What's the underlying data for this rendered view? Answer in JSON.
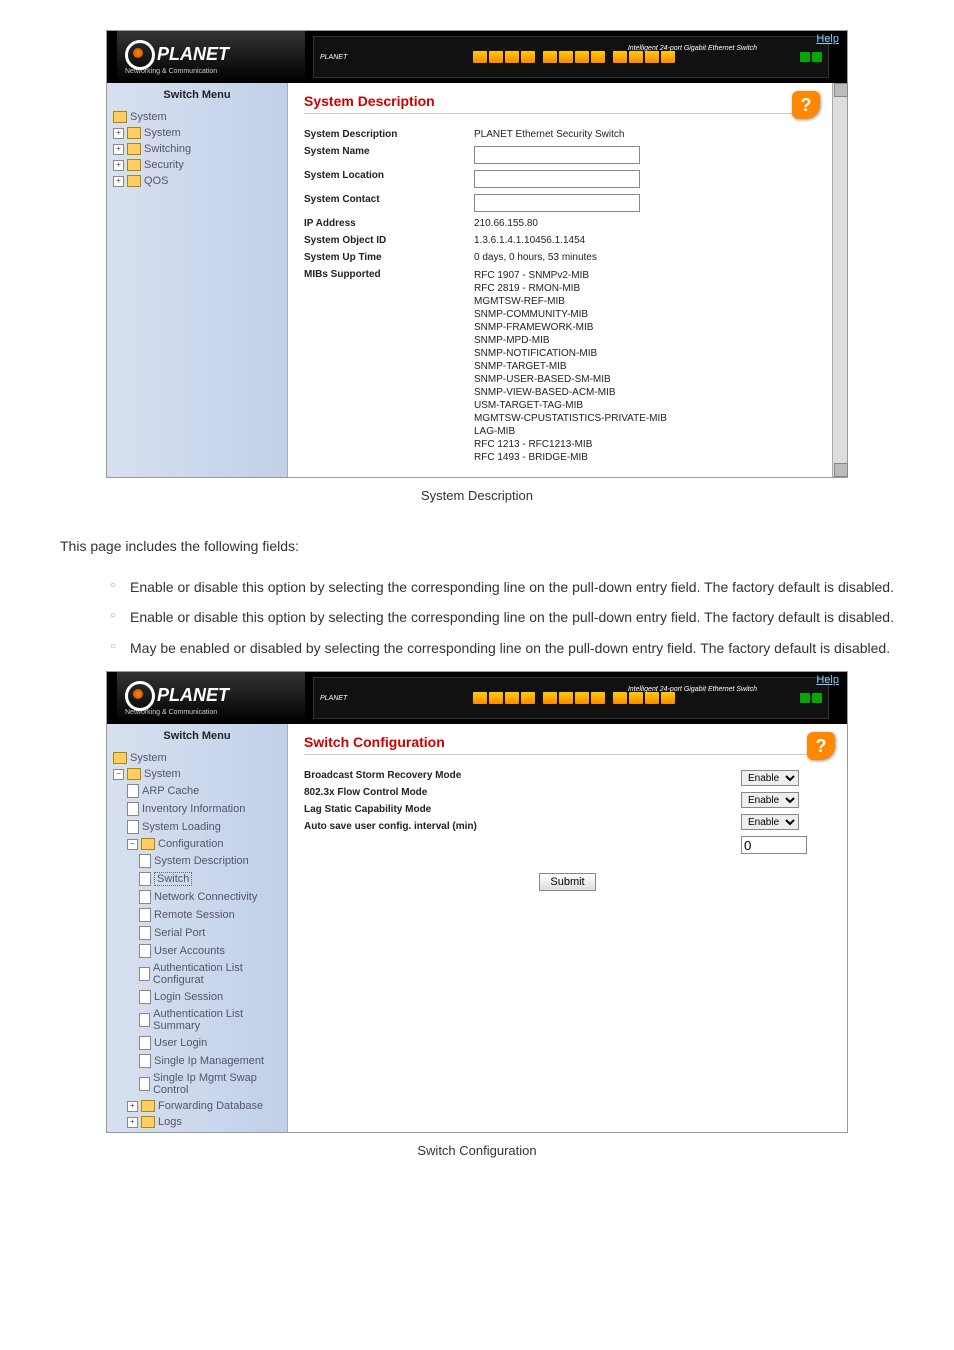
{
  "logo": {
    "brand": "PLANET",
    "tag": "Networking & Communication"
  },
  "banner": {
    "help": "Help",
    "device": "Intelligent 24-port Gigabit Ethernet Switch"
  },
  "shot1": {
    "sidebar_title": "Switch Menu",
    "tree": {
      "root": "System",
      "items": [
        "System",
        "Switching",
        "Security",
        "QOS"
      ]
    },
    "title": "System Description",
    "rows": {
      "desc_label": "System Description",
      "desc_val": "PLANET Ethernet Security Switch",
      "name_label": "System Name",
      "loc_label": "System Location",
      "contact_label": "System Contact",
      "ip_label": "IP Address",
      "ip_val": "210.66.155.80",
      "oid_label": "System Object ID",
      "oid_val": "1.3.6.1.4.1.10456.1.1454",
      "uptime_label": "System Up Time",
      "uptime_val": "0 days, 0 hours, 53 minutes",
      "mibs_label": "MIBs Supported",
      "mibs": [
        "RFC 1907 - SNMPv2-MIB",
        "RFC 2819 - RMON-MIB",
        "MGMTSW-REF-MIB",
        "SNMP-COMMUNITY-MIB",
        "SNMP-FRAMEWORK-MIB",
        "SNMP-MPD-MIB",
        "SNMP-NOTIFICATION-MIB",
        "SNMP-TARGET-MIB",
        "SNMP-USER-BASED-SM-MIB",
        "SNMP-VIEW-BASED-ACM-MIB",
        "USM-TARGET-TAG-MIB",
        "MGMTSW-CPUSTATISTICS-PRIVATE-MIB",
        "LAG-MIB",
        "RFC 1213 - RFC1213-MIB",
        "RFC 1493 - BRIDGE-MIB"
      ]
    }
  },
  "caption1": "System Description",
  "doc": {
    "intro": "This page includes the following fields:",
    "b1": "Enable or disable this option by selecting the corresponding line on the pull-down entry field. The factory default is disabled.",
    "b2": "Enable or disable this option by selecting the corresponding line on the pull-down entry field. The factory default is disabled.",
    "b3": "May be enabled or disabled by selecting the corresponding line on the pull-down entry field. The factory default is disabled."
  },
  "shot2": {
    "sidebar_title": "Switch Menu",
    "tree": {
      "root": "System",
      "l1": "System",
      "items": [
        "ARP Cache",
        "Inventory Information",
        "System Loading"
      ],
      "config": "Configuration",
      "cfg_items": [
        "System Description",
        "Switch",
        "Network Connectivity",
        "Remote Session",
        "Serial Port",
        "User Accounts",
        "Authentication List Configurat",
        "Login Session",
        "Authentication List Summary",
        "User Login",
        "Single Ip Management",
        "Single Ip Mgmt Swap Control"
      ],
      "fwd": "Forwarding Database",
      "logs": "Logs"
    },
    "title": "Switch Configuration",
    "rows": {
      "bcast": "Broadcast Storm Recovery Mode",
      "flow": "802.3x Flow Control Mode",
      "lag": "Lag Static Capability Mode",
      "auto": "Auto save user config. interval (min)"
    },
    "vals": {
      "enable": "Enable",
      "zero": "0"
    },
    "submit": "Submit"
  },
  "caption2": "Switch Configuration"
}
